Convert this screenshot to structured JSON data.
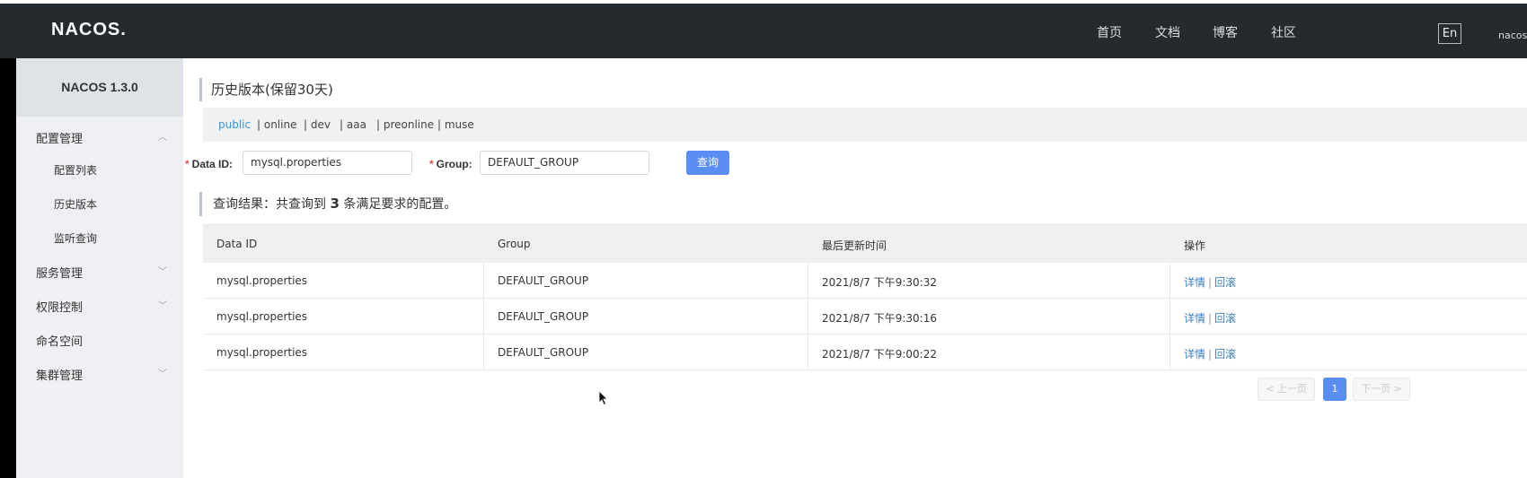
{
  "header": {
    "logo": "NACOS.",
    "nav": [
      "首页",
      "文档",
      "博客",
      "社区"
    ],
    "lang": "En",
    "user": "nacos"
  },
  "sidebar": {
    "version": "NACOS 1.3.0",
    "menus": [
      {
        "label": "配置管理",
        "expanded": true
      },
      {
        "label": "服务管理",
        "expanded": false
      },
      {
        "label": "权限控制",
        "expanded": false
      },
      {
        "label": "命名空间"
      },
      {
        "label": "集群管理",
        "expanded": false
      }
    ],
    "submenu": [
      "配置列表",
      "历史版本",
      "监听查询"
    ]
  },
  "page": {
    "title": "历史版本(保留30天)",
    "namespaces": [
      "public",
      "| online",
      "| dev",
      "| aaa",
      "| preonline",
      "| muse"
    ],
    "active_namespace": "public"
  },
  "search": {
    "data_id_label": "Data ID:",
    "data_id_value": "mysql.properties",
    "group_label": "Group:",
    "group_value": "DEFAULT_GROUP",
    "button": "查询",
    "required_mark": "*"
  },
  "result": {
    "prefix": "查询结果：共查询到",
    "count": "3",
    "suffix": "条满足要求的配置。"
  },
  "table": {
    "headers": [
      "Data ID",
      "Group",
      "最后更新时间",
      "操作"
    ],
    "rows": [
      {
        "data_id": "mysql.properties",
        "group": "DEFAULT_GROUP",
        "time": "2021/8/7 下午9:30:32",
        "detail": "详情",
        "sep": "|",
        "rollback": "回滚"
      },
      {
        "data_id": "mysql.properties",
        "group": "DEFAULT_GROUP",
        "time": "2021/8/7 下午9:30:16",
        "detail": "详情",
        "sep": "|",
        "rollback": "回滚"
      },
      {
        "data_id": "mysql.properties",
        "group": "DEFAULT_GROUP",
        "time": "2021/8/7 下午9:00:22",
        "detail": "详情",
        "sep": "|",
        "rollback": "回滚"
      }
    ]
  },
  "pagination": {
    "prev": "< 上一页",
    "current": "1",
    "next": "下一页 >"
  }
}
